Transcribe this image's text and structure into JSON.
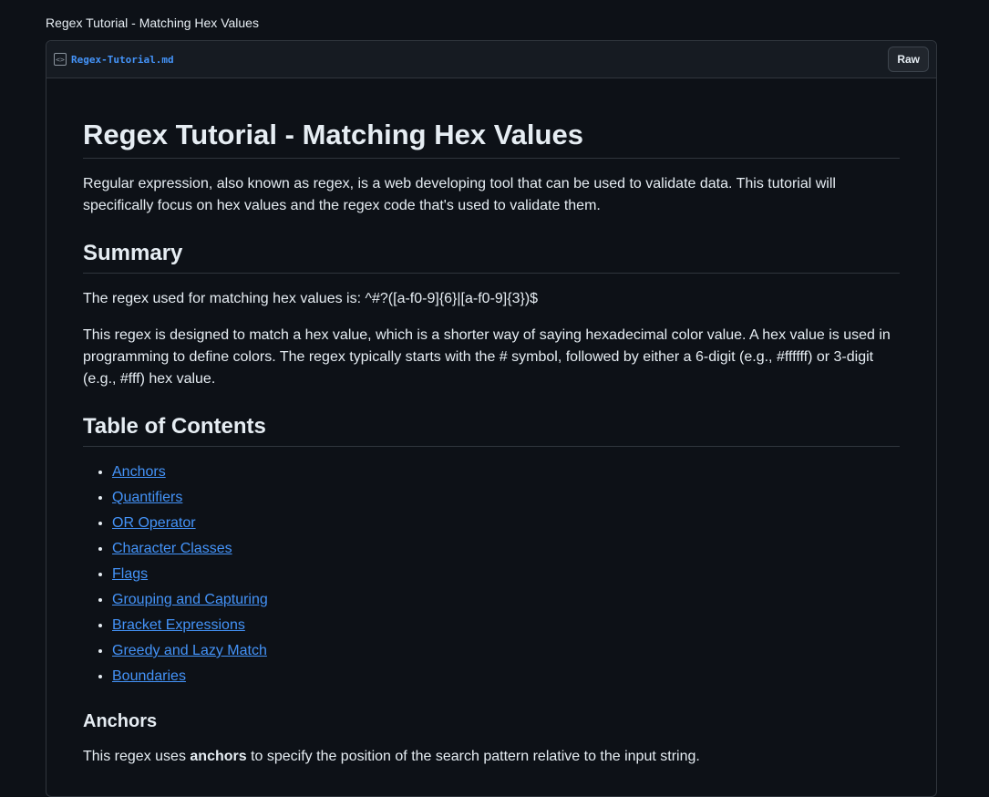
{
  "header": {
    "page_title": "Regex Tutorial - Matching Hex Values",
    "file_name": "Regex-Tutorial.md",
    "raw_label": "Raw",
    "file_icon": "code-file-icon"
  },
  "article": {
    "title": "Regex Tutorial - Matching Hex Values",
    "intro": "Regular expression, also known as regex, is a web developing tool that can be used to validate data. This tutorial will specifically focus on hex values and the regex code that's used to validate them.",
    "summary_heading": "Summary",
    "summary_regex": "The regex used for matching hex values is: ^#?([a-f0-9]{6}|[a-f0-9]{3})$",
    "summary_desc": "This regex is designed to match a hex value, which is a shorter way of saying hexadecimal color value. A hex value is used in programming to define colors. The regex typically starts with the # symbol, followed by either a 6-digit (e.g., #ffffff) or 3-digit (e.g., #fff) hex value.",
    "toc_heading": "Table of Contents",
    "toc": [
      "Anchors",
      "Quantifiers",
      "OR Operator",
      "Character Classes",
      "Flags",
      "Grouping and Capturing",
      "Bracket Expressions",
      "Greedy and Lazy Match",
      "Boundaries"
    ],
    "anchors_heading": "Anchors",
    "anchors_pre": "This regex uses ",
    "anchors_bold": "anchors",
    "anchors_post": " to specify the position of the search pattern relative to the input string."
  },
  "colors": {
    "background": "#0d1117",
    "link": "#4493f8",
    "border": "#30363d"
  }
}
